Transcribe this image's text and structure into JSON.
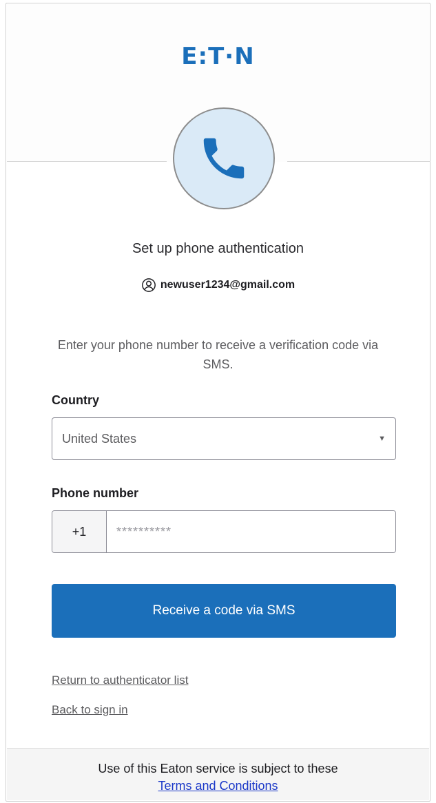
{
  "brand": {
    "logo_text": "E:T·N",
    "accent": "#1b6fba",
    "link_color": "#1a38c8"
  },
  "auth": {
    "icon": "phone-icon",
    "title": "Set up phone authentication",
    "user_icon": "user-circle-icon",
    "user_email": "newuser1234@gmail.com",
    "instructions": "Enter your phone number to receive a verification code via SMS."
  },
  "form": {
    "country_label": "Country",
    "country_value": "United States",
    "phone_label": "Phone number",
    "phone_prefix": "+1",
    "phone_placeholder": "**********",
    "submit_label": "Receive a code via SMS"
  },
  "links": {
    "return_label": "Return to authenticator list",
    "back_label": "Back to sign in"
  },
  "footer": {
    "text": "Use of this Eaton service is subject to these",
    "terms_label": "Terms and Conditions"
  }
}
